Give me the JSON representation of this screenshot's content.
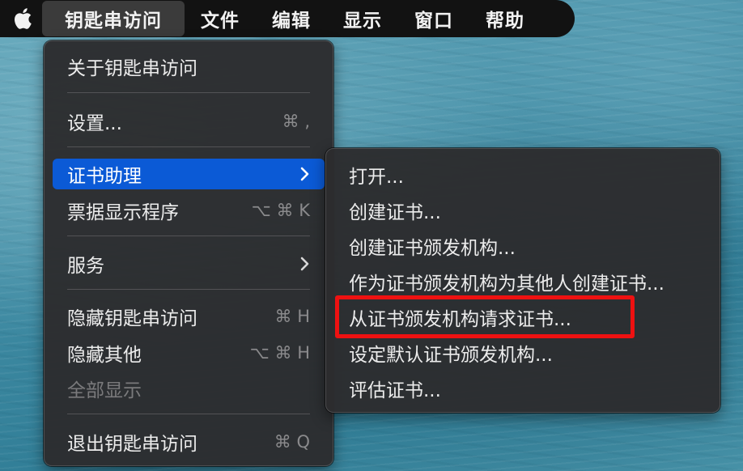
{
  "menubar": {
    "app_name": "钥匙串访问",
    "items": [
      "文件",
      "编辑",
      "显示",
      "窗口",
      "帮助"
    ]
  },
  "app_menu": {
    "about": "关于钥匙串访问",
    "settings": {
      "label": "设置...",
      "shortcut": "⌘ ,"
    },
    "cert_assistant": "证书助理",
    "ticket_viewer": {
      "label": "票据显示程序",
      "shortcut": "⌥ ⌘ K"
    },
    "services": "服务",
    "hide": {
      "label": "隐藏钥匙串访问",
      "shortcut": "⌘ H"
    },
    "hide_others": {
      "label": "隐藏其他",
      "shortcut": "⌥ ⌘ H"
    },
    "show_all": "全部显示",
    "quit": {
      "label": "退出钥匙串访问",
      "shortcut": "⌘ Q"
    }
  },
  "cert_submenu": {
    "items": [
      "打开...",
      "创建证书...",
      "创建证书颁发机构...",
      "作为证书颁发机构为其他人创建证书...",
      "从证书颁发机构请求证书...",
      "设定默认证书颁发机构...",
      "评估证书..."
    ]
  },
  "colors": {
    "highlight": "#0b5ad6",
    "annotation": "#ee1111"
  }
}
